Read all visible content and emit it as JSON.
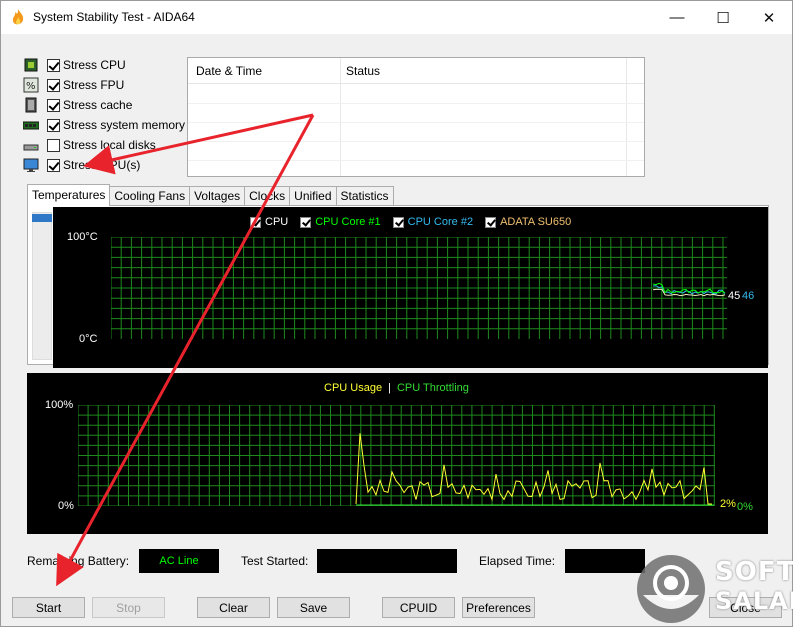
{
  "window": {
    "title": "System Stability Test - AIDA64",
    "minimize_glyph": "—",
    "maximize_glyph": "☐",
    "close_glyph": "✕"
  },
  "stress_options": [
    {
      "label": "Stress CPU",
      "checked": true,
      "icon": "cpu-chip-icon"
    },
    {
      "label": "Stress FPU",
      "checked": true,
      "icon": "fpu-percent-icon"
    },
    {
      "label": "Stress cache",
      "checked": true,
      "icon": "cache-icon"
    },
    {
      "label": "Stress system memory",
      "checked": true,
      "icon": "memory-module-icon"
    },
    {
      "label": "Stress local disks",
      "checked": false,
      "icon": "disk-drive-icon"
    },
    {
      "label": "Stress GPU(s)",
      "checked": true,
      "icon": "monitor-icon"
    }
  ],
  "log": {
    "col_date": "Date & Time",
    "col_status": "Status"
  },
  "tabs": [
    "Temperatures",
    "Cooling Fans",
    "Voltages",
    "Clocks",
    "Unified",
    "Statistics"
  ],
  "temperature_chart": {
    "legend": [
      {
        "label": "CPU",
        "color": "#ffffff"
      },
      {
        "label": "CPU Core #1",
        "color": "#00ff00"
      },
      {
        "label": "CPU Core #2",
        "color": "#33bbee"
      },
      {
        "label": "ADATA SU650",
        "color": "#f0c070"
      }
    ],
    "y_top": "100°C",
    "y_bottom": "0°C",
    "value_a": "45",
    "value_b": "46",
    "grid_color": "#1d8a1d"
  },
  "usage_chart": {
    "legend_usage": "CPU Usage",
    "legend_separator": "|",
    "legend_throttling": "CPU Throttling",
    "usage_color": "#ffff33",
    "throttling_color": "#33dd33",
    "y_top": "100%",
    "y_bottom": "0%",
    "usage_value": "2%",
    "throttling_value": "0%"
  },
  "status": {
    "battery_label": "Remaining Battery:",
    "battery_value": "AC Line",
    "started_label": "Test Started:",
    "started_value": "",
    "elapsed_label": "Elapsed Time:",
    "elapsed_value": ""
  },
  "buttons": {
    "start": "Start",
    "stop": "Stop",
    "clear": "Clear",
    "save": "Save",
    "cpuid": "CPUID",
    "preferences": "Preferences",
    "close": "Close"
  },
  "watermark": {
    "line1": "SOFT",
    "line2": "SALAD"
  }
}
